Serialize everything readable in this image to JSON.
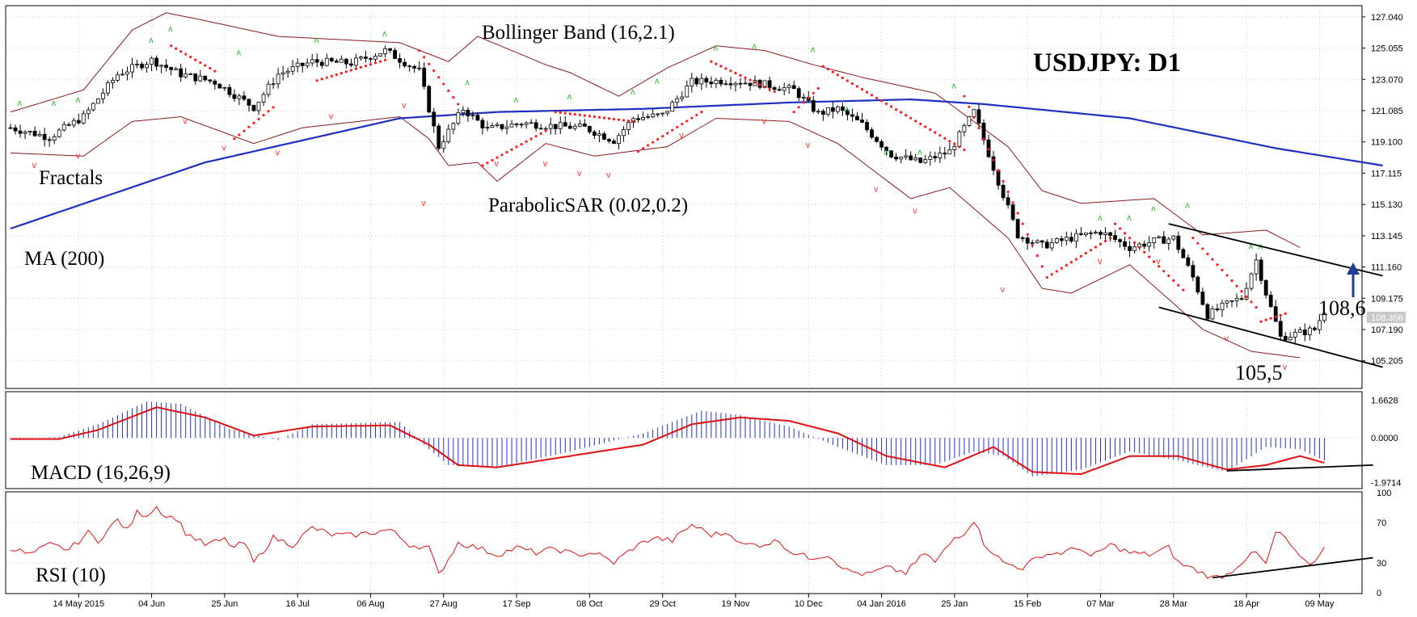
{
  "chart_data": {
    "type": "candlestick",
    "title": "USDJPY: D1",
    "current_price": "108.356",
    "price_ticks": [
      "127.040",
      "125.055",
      "123.070",
      "121.085",
      "119.100",
      "117.115",
      "115.130",
      "113.145",
      "111.160",
      "109.175",
      "107.190",
      "105.205"
    ],
    "price_ticks_values": [
      127.04,
      125.055,
      123.07,
      121.085,
      119.1,
      117.115,
      115.13,
      113.145,
      111.16,
      109.175,
      107.19,
      105.205
    ],
    "price_range": [
      103.5,
      127.7
    ],
    "macd_ticks": [
      "1.6628",
      "0.0000",
      "-1.9714"
    ],
    "macd_ticks_values": [
      1.6628,
      0,
      -1.9714
    ],
    "macd_range": [
      -2.2,
      2.0
    ],
    "rsi_ticks": [
      "100",
      "70",
      "30",
      "0"
    ],
    "rsi_ticks_values": [
      100,
      70,
      30,
      0
    ],
    "x_ticks": [
      "14 May 2015",
      "04 Jun",
      "25 Jun",
      "16 Jul",
      "06 Aug",
      "27 Aug",
      "17 Sep",
      "08 Oct",
      "29 Oct",
      "19 Nov",
      "10 Dec",
      "04 Jan 2016",
      "25 Jan",
      "15 Feb",
      "07 Mar",
      "28 Mar",
      "18 Apr",
      "09 May"
    ],
    "x_ticks_bar_index": [
      14,
      29,
      44,
      59,
      74,
      89,
      104,
      119,
      134,
      149,
      164,
      179,
      194,
      209,
      224,
      239,
      254,
      269
    ],
    "annotations": {
      "bollinger": "Bollinger Band (16,2.1)",
      "fractals": "Fractals",
      "ma": "MA (200)",
      "sar": "ParabolicSAR (0.02,0.2)",
      "macd": "MACD (16,26,9)",
      "rsi": "RSI (10)",
      "resistance_label": "108,6",
      "support_label": "105,5"
    },
    "close_anchors": [
      [
        0,
        120.0
      ],
      [
        8,
        119.4
      ],
      [
        15,
        120.7
      ],
      [
        22,
        123.4
      ],
      [
        29,
        124.3
      ],
      [
        35,
        123.4
      ],
      [
        42,
        122.9
      ],
      [
        50,
        121.3
      ],
      [
        55,
        123.4
      ],
      [
        62,
        124.2
      ],
      [
        70,
        124.1
      ],
      [
        77,
        124.9
      ],
      [
        84,
        123.6
      ],
      [
        88,
        118.8
      ],
      [
        93,
        121.2
      ],
      [
        98,
        119.9
      ],
      [
        105,
        120.3
      ],
      [
        112,
        120.1
      ],
      [
        118,
        120.0
      ],
      [
        124,
        119.2
      ],
      [
        128,
        120.6
      ],
      [
        134,
        120.8
      ],
      [
        140,
        122.9
      ],
      [
        147,
        123.0
      ],
      [
        154,
        122.8
      ],
      [
        161,
        122.4
      ],
      [
        166,
        120.9
      ],
      [
        170,
        121.2
      ],
      [
        175,
        120.2
      ],
      [
        181,
        118.3
      ],
      [
        187,
        117.8
      ],
      [
        193,
        118.5
      ],
      [
        198,
        121.0
      ],
      [
        203,
        116.6
      ],
      [
        207,
        113.2
      ],
      [
        212,
        112.5
      ],
      [
        218,
        113.0
      ],
      [
        224,
        113.4
      ],
      [
        230,
        112.4
      ],
      [
        235,
        112.8
      ],
      [
        239,
        113.0
      ],
      [
        243,
        110.5
      ],
      [
        246,
        108.1
      ],
      [
        250,
        108.8
      ],
      [
        253,
        109.2
      ],
      [
        256,
        111.6
      ],
      [
        258,
        109.5
      ],
      [
        261,
        106.7
      ],
      [
        264,
        106.9
      ],
      [
        268,
        107.2
      ],
      [
        270,
        108.4
      ]
    ],
    "ma200_anchors": [
      [
        0,
        113.6
      ],
      [
        40,
        117.8
      ],
      [
        80,
        120.6
      ],
      [
        100,
        121.0
      ],
      [
        130,
        121.2
      ],
      [
        160,
        121.6
      ],
      [
        185,
        121.8
      ],
      [
        200,
        121.5
      ],
      [
        230,
        120.6
      ],
      [
        260,
        118.7
      ],
      [
        282,
        117.6
      ]
    ],
    "bb_upper_anchors": [
      [
        0,
        121.0
      ],
      [
        15,
        122.4
      ],
      [
        25,
        126.2
      ],
      [
        32,
        127.3
      ],
      [
        40,
        126.8
      ],
      [
        55,
        125.8
      ],
      [
        80,
        125.4
      ],
      [
        90,
        124.2
      ],
      [
        96,
        125.8
      ],
      [
        110,
        124.0
      ],
      [
        115,
        123.5
      ],
      [
        125,
        122.0
      ],
      [
        135,
        123.8
      ],
      [
        145,
        125.2
      ],
      [
        155,
        124.9
      ],
      [
        165,
        124.0
      ],
      [
        175,
        123.2
      ],
      [
        190,
        122.2
      ],
      [
        205,
        118.8
      ],
      [
        212,
        116.0
      ],
      [
        220,
        115.2
      ],
      [
        235,
        115.5
      ],
      [
        245,
        113.2
      ],
      [
        258,
        113.5
      ],
      [
        265,
        112.4
      ]
    ],
    "bb_lower_anchors": [
      [
        0,
        118.4
      ],
      [
        15,
        118.2
      ],
      [
        25,
        120.4
      ],
      [
        35,
        120.7
      ],
      [
        50,
        119.0
      ],
      [
        60,
        120.0
      ],
      [
        80,
        120.7
      ],
      [
        86,
        119.3
      ],
      [
        90,
        117.6
      ],
      [
        96,
        117.8
      ],
      [
        100,
        116.6
      ],
      [
        110,
        119.0
      ],
      [
        120,
        118.2
      ],
      [
        135,
        118.8
      ],
      [
        145,
        120.6
      ],
      [
        160,
        120.4
      ],
      [
        170,
        119.0
      ],
      [
        185,
        115.5
      ],
      [
        193,
        116.2
      ],
      [
        205,
        113.0
      ],
      [
        212,
        109.8
      ],
      [
        218,
        109.5
      ],
      [
        230,
        111.3
      ],
      [
        245,
        107.2
      ],
      [
        255,
        105.8
      ],
      [
        265,
        105.4
      ]
    ],
    "sar_segments": [
      [
        [
          33,
          125.2
        ],
        [
          42,
          123.6
        ]
      ],
      [
        [
          46,
          119.3
        ],
        [
          54,
          121.3
        ]
      ],
      [
        [
          63,
          123.0
        ],
        [
          77,
          124.3
        ]
      ],
      [
        [
          84,
          124.9
        ],
        [
          92,
          121.5
        ]
      ],
      [
        [
          97,
          117.6
        ],
        [
          110,
          119.8
        ]
      ],
      [
        [
          112,
          121.0
        ],
        [
          128,
          120.4
        ]
      ],
      [
        [
          129,
          118.5
        ],
        [
          142,
          121.0
        ]
      ],
      [
        [
          144,
          124.2
        ],
        [
          157,
          122.3
        ]
      ],
      [
        [
          161,
          121.0
        ],
        [
          166,
          122.5
        ]
      ],
      [
        [
          167,
          123.9
        ],
        [
          196,
          118.6
        ]
      ],
      [
        [
          196,
          122.0
        ],
        [
          212,
          111.2
        ]
      ],
      [
        [
          213,
          110.5
        ],
        [
          226,
          113.0
        ]
      ],
      [
        [
          227,
          113.9
        ],
        [
          241,
          109.7
        ]
      ],
      [
        [
          243,
          113.0
        ],
        [
          256,
          108.6
        ]
      ],
      [
        [
          257,
          107.7
        ],
        [
          262,
          108.2
        ]
      ]
    ],
    "fractals_up": [
      [
        2,
        121.3
      ],
      [
        9,
        121.3
      ],
      [
        14,
        121.5
      ],
      [
        29,
        125.3
      ],
      [
        33,
        126.0
      ],
      [
        47,
        124.5
      ],
      [
        63,
        125.3
      ],
      [
        77,
        125.7
      ],
      [
        94,
        122.6
      ],
      [
        104,
        121.5
      ],
      [
        115,
        121.7
      ],
      [
        128,
        122.0
      ],
      [
        133,
        122.7
      ],
      [
        145,
        124.8
      ],
      [
        153,
        124.9
      ],
      [
        165,
        124.7
      ],
      [
        172,
        120.9
      ],
      [
        180,
        118.2
      ],
      [
        187,
        118.2
      ],
      [
        194,
        122.4
      ],
      [
        224,
        114.0
      ],
      [
        230,
        114.0
      ],
      [
        235,
        114.6
      ],
      [
        242,
        114.8
      ],
      [
        255,
        112.2
      ],
      [
        257,
        112.2
      ]
    ],
    "fractals_down": [
      [
        5,
        117.9
      ],
      [
        14,
        118.5
      ],
      [
        36,
        120.7
      ],
      [
        44,
        119.0
      ],
      [
        55,
        118.7
      ],
      [
        66,
        121.0
      ],
      [
        81,
        121.7
      ],
      [
        85,
        115.5
      ],
      [
        100,
        118.0
      ],
      [
        110,
        118.0
      ],
      [
        117,
        117.4
      ],
      [
        123,
        117.3
      ],
      [
        138,
        119.8
      ],
      [
        155,
        120.7
      ],
      [
        164,
        119.2
      ],
      [
        178,
        116.4
      ],
      [
        186,
        115.0
      ],
      [
        204,
        110.0
      ],
      [
        224,
        111.8
      ],
      [
        236,
        111.8
      ],
      [
        250,
        106.9
      ],
      [
        262,
        105.1
      ]
    ],
    "channel_upper": [
      [
        238,
        113.9
      ],
      [
        282,
        110.6
      ]
    ],
    "channel_lower": [
      [
        236,
        108.6
      ],
      [
        282,
        104.8
      ]
    ],
    "macd_signal_anchors": [
      [
        0,
        -0.05
      ],
      [
        10,
        -0.05
      ],
      [
        18,
        0.35
      ],
      [
        30,
        1.35
      ],
      [
        40,
        0.9
      ],
      [
        50,
        0.1
      ],
      [
        62,
        0.5
      ],
      [
        78,
        0.55
      ],
      [
        86,
        -0.3
      ],
      [
        92,
        -1.2
      ],
      [
        100,
        -1.3
      ],
      [
        115,
        -0.8
      ],
      [
        130,
        -0.3
      ],
      [
        140,
        0.6
      ],
      [
        150,
        0.9
      ],
      [
        160,
        0.75
      ],
      [
        170,
        0.2
      ],
      [
        180,
        -0.8
      ],
      [
        192,
        -1.3
      ],
      [
        202,
        -0.4
      ],
      [
        210,
        -1.5
      ],
      [
        220,
        -1.6
      ],
      [
        230,
        -0.8
      ],
      [
        240,
        -0.8
      ],
      [
        250,
        -1.4
      ],
      [
        258,
        -1.2
      ],
      [
        265,
        -0.8
      ],
      [
        270,
        -1.1
      ]
    ],
    "macd_hist_anchors": [
      [
        0,
        -0.05
      ],
      [
        10,
        0.05
      ],
      [
        18,
        0.6
      ],
      [
        28,
        1.6
      ],
      [
        35,
        1.5
      ],
      [
        45,
        0.4
      ],
      [
        55,
        -0.1
      ],
      [
        62,
        0.6
      ],
      [
        80,
        0.7
      ],
      [
        86,
        -0.5
      ],
      [
        90,
        -1.2
      ],
      [
        100,
        -1.3
      ],
      [
        115,
        -0.6
      ],
      [
        130,
        0.2
      ],
      [
        142,
        1.2
      ],
      [
        150,
        1.0
      ],
      [
        160,
        0.5
      ],
      [
        170,
        -0.4
      ],
      [
        180,
        -1.2
      ],
      [
        190,
        -1.2
      ],
      [
        198,
        -0.6
      ],
      [
        204,
        -0.8
      ],
      [
        210,
        -1.7
      ],
      [
        220,
        -1.4
      ],
      [
        230,
        -0.6
      ],
      [
        240,
        -1.0
      ],
      [
        250,
        -1.5
      ],
      [
        258,
        -0.4
      ],
      [
        265,
        -0.5
      ],
      [
        270,
        -1.0
      ]
    ],
    "macd_trend": [
      [
        250,
        -1.45
      ],
      [
        280,
        -1.2
      ]
    ],
    "rsi_anchors": [
      [
        0,
        45
      ],
      [
        4,
        38
      ],
      [
        8,
        48
      ],
      [
        12,
        43
      ],
      [
        16,
        60
      ],
      [
        18,
        52
      ],
      [
        22,
        73
      ],
      [
        24,
        62
      ],
      [
        26,
        80
      ],
      [
        28,
        78
      ],
      [
        30,
        86
      ],
      [
        32,
        76
      ],
      [
        34,
        75
      ],
      [
        36,
        60
      ],
      [
        40,
        48
      ],
      [
        44,
        53
      ],
      [
        46,
        45
      ],
      [
        48,
        50
      ],
      [
        50,
        30
      ],
      [
        54,
        55
      ],
      [
        58,
        48
      ],
      [
        62,
        65
      ],
      [
        66,
        58
      ],
      [
        70,
        57
      ],
      [
        74,
        60
      ],
      [
        78,
        63
      ],
      [
        82,
        48
      ],
      [
        86,
        45
      ],
      [
        88,
        18
      ],
      [
        92,
        50
      ],
      [
        96,
        45
      ],
      [
        100,
        38
      ],
      [
        104,
        45
      ],
      [
        108,
        40
      ],
      [
        112,
        44
      ],
      [
        116,
        38
      ],
      [
        120,
        40
      ],
      [
        124,
        30
      ],
      [
        128,
        45
      ],
      [
        132,
        55
      ],
      [
        136,
        52
      ],
      [
        140,
        68
      ],
      [
        144,
        58
      ],
      [
        148,
        60
      ],
      [
        150,
        48
      ],
      [
        154,
        48
      ],
      [
        158,
        52
      ],
      [
        160,
        42
      ],
      [
        164,
        35
      ],
      [
        168,
        38
      ],
      [
        172,
        22
      ],
      [
        176,
        18
      ],
      [
        180,
        25
      ],
      [
        184,
        20
      ],
      [
        188,
        40
      ],
      [
        190,
        30
      ],
      [
        194,
        55
      ],
      [
        196,
        60
      ],
      [
        198,
        73
      ],
      [
        200,
        50
      ],
      [
        202,
        40
      ],
      [
        204,
        30
      ],
      [
        208,
        25
      ],
      [
        212,
        38
      ],
      [
        216,
        40
      ],
      [
        220,
        45
      ],
      [
        222,
        35
      ],
      [
        226,
        48
      ],
      [
        230,
        40
      ],
      [
        234,
        38
      ],
      [
        238,
        45
      ],
      [
        240,
        30
      ],
      [
        244,
        22
      ],
      [
        247,
        15
      ],
      [
        250,
        18
      ],
      [
        254,
        35
      ],
      [
        256,
        40
      ],
      [
        258,
        28
      ],
      [
        260,
        60
      ],
      [
        262,
        55
      ],
      [
        264,
        40
      ],
      [
        266,
        30
      ],
      [
        268,
        30
      ],
      [
        270,
        48
      ]
    ],
    "rsi_trend": [
      [
        247,
        15
      ],
      [
        280,
        35
      ]
    ]
  }
}
